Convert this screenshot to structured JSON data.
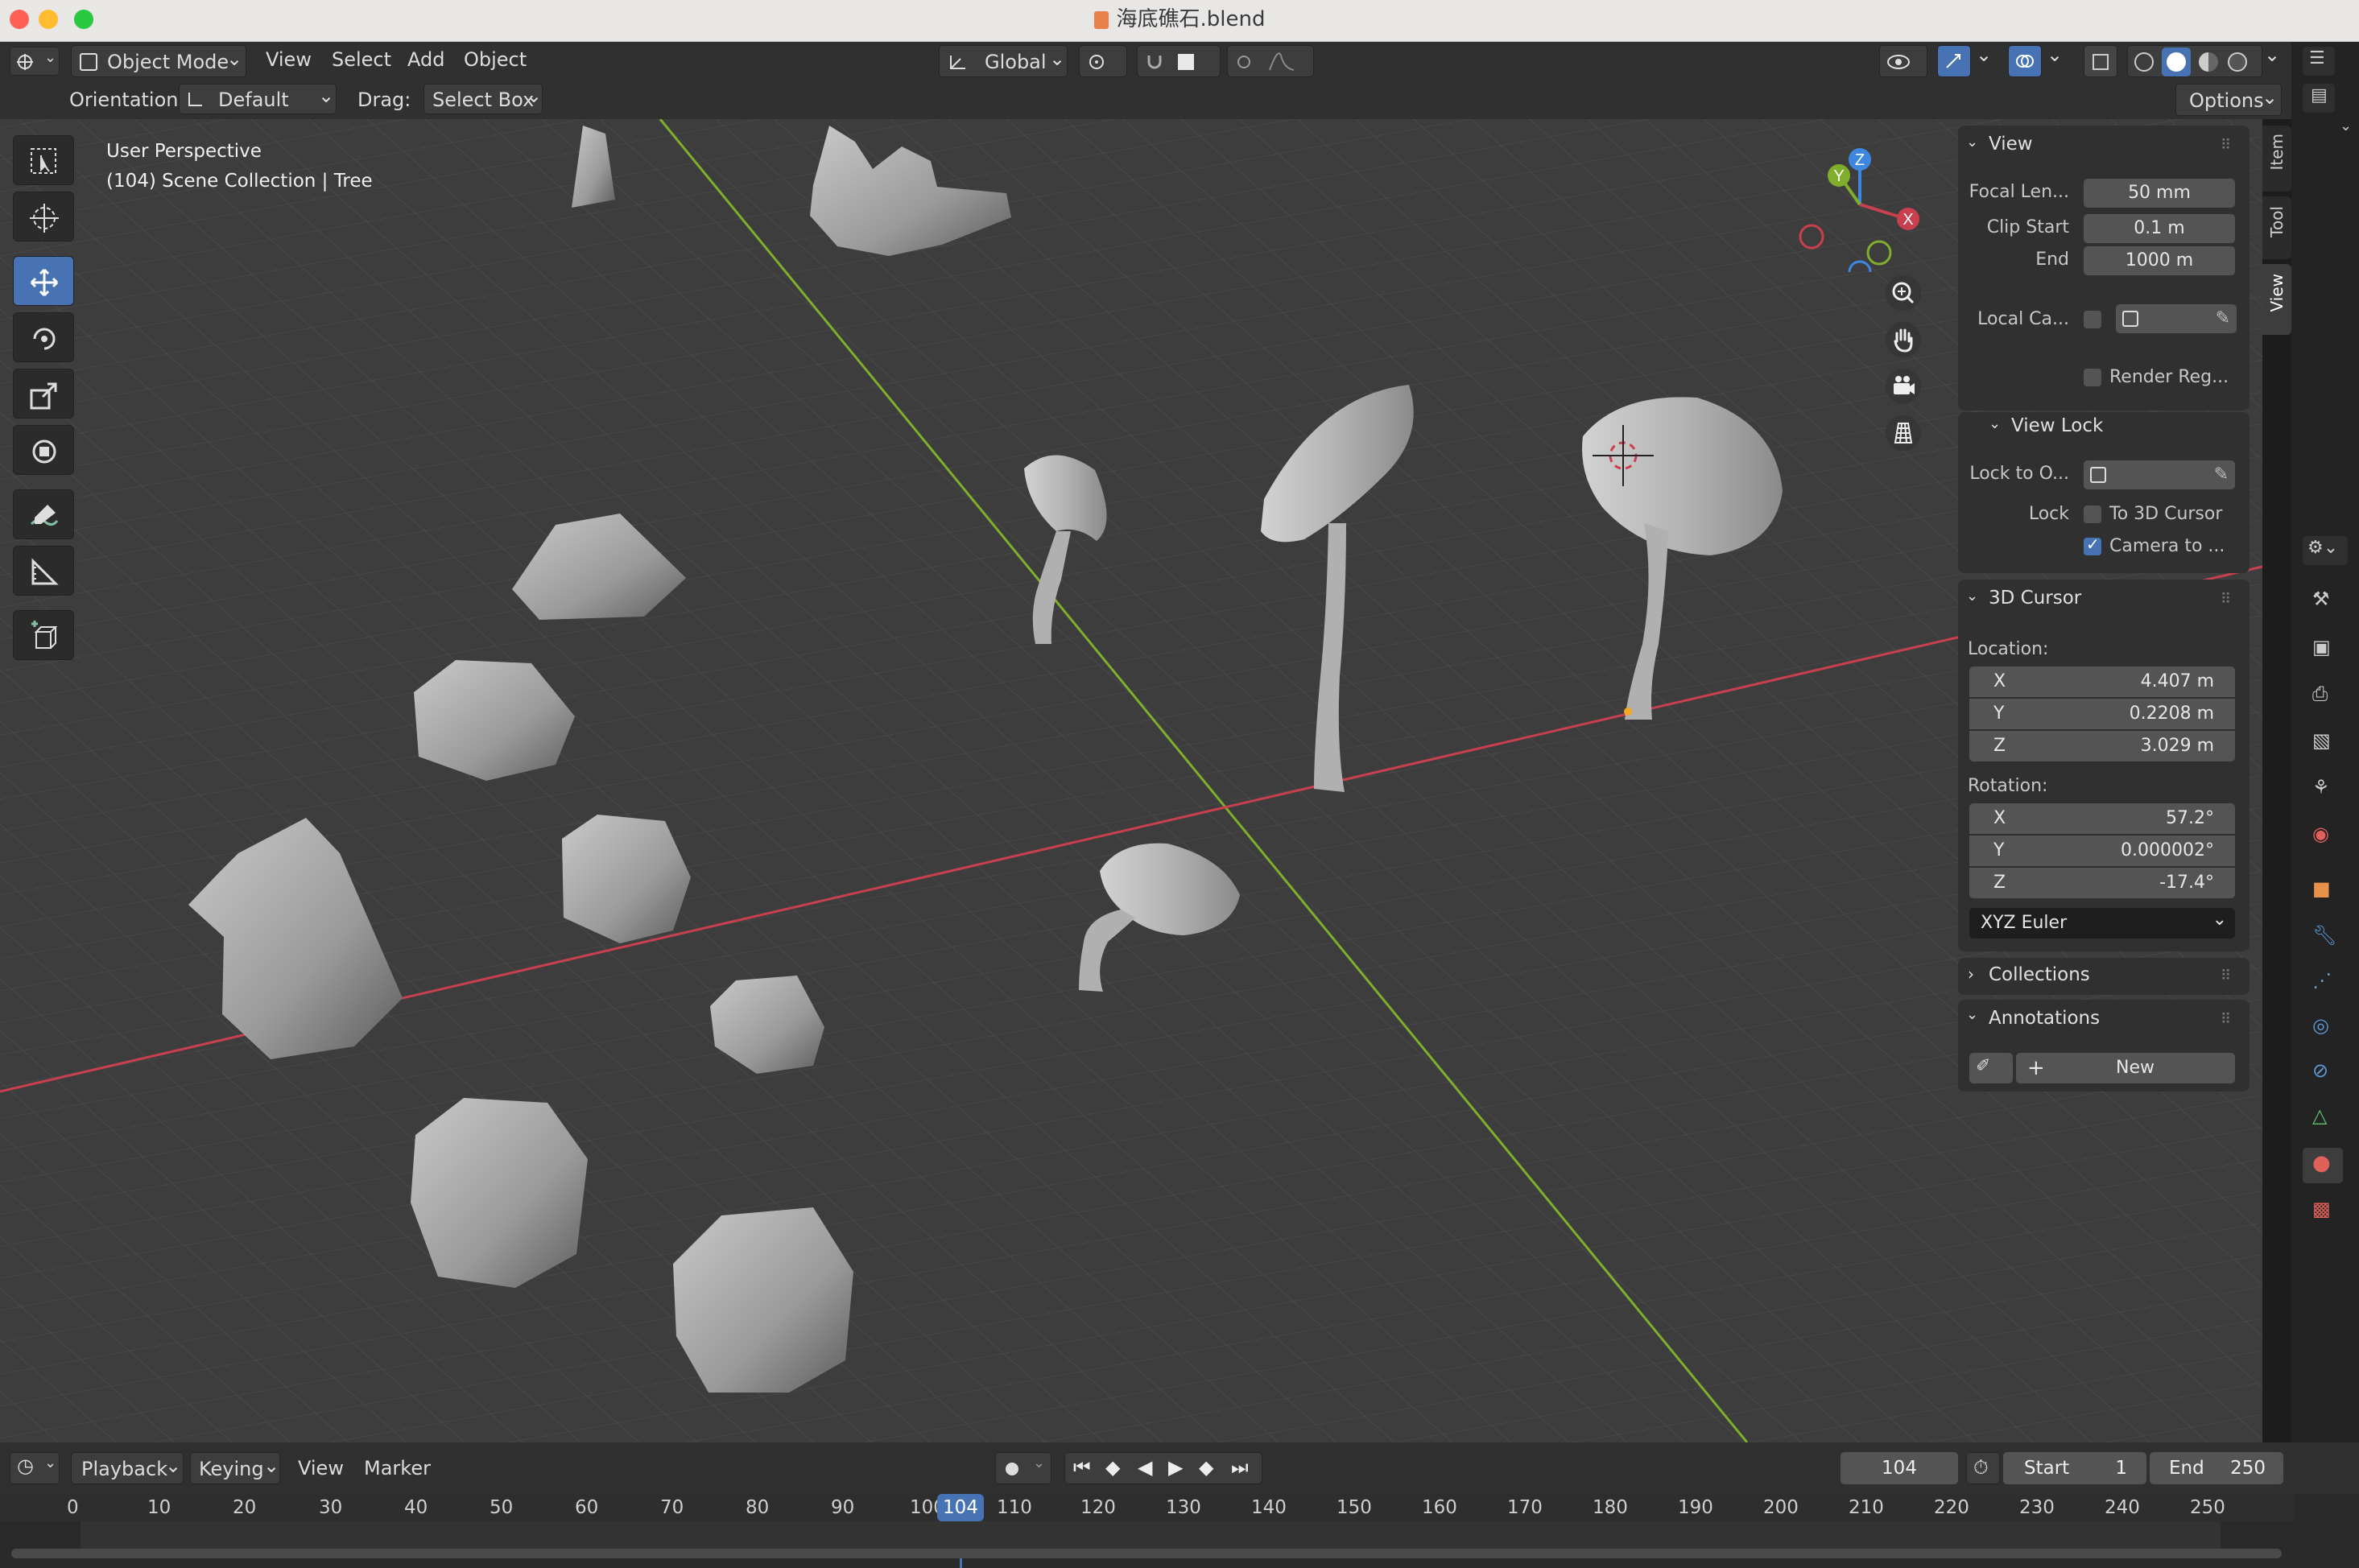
{
  "window": {
    "title": "海底礁石.blend",
    "traffic_colors": [
      "#fe5f57",
      "#febc2e",
      "#28c840"
    ]
  },
  "header": {
    "mode": "Object Mode",
    "menus": [
      "View",
      "Select",
      "Add",
      "Object"
    ],
    "transform_orientation": "Global",
    "options": "Options",
    "orientation_label": "Orientation:",
    "orientation_value": "Default",
    "drag_label": "Drag:",
    "drag_value": "Select Box"
  },
  "viewport": {
    "perspective": "User Perspective",
    "collection": "(104) Scene Collection | Tree",
    "gizmo_axes": [
      "X",
      "Y",
      "Z"
    ]
  },
  "toolbar": {
    "tools": [
      "select-box",
      "cursor",
      "move",
      "rotate",
      "scale",
      "transform",
      "annotate",
      "measure",
      "add-cube"
    ],
    "active": "move"
  },
  "sidebar_tabs": [
    "Item",
    "Tool",
    "View"
  ],
  "n_panel": {
    "view": {
      "title": "View",
      "focal_label": "Focal Len...",
      "focal_value": "50 mm",
      "clip_start_label": "Clip Start",
      "clip_start_value": "0.1 m",
      "end_label": "End",
      "end_value": "1000 m",
      "local_camera_label": "Local Ca...",
      "render_region_label": "Render Reg..."
    },
    "view_lock": {
      "title": "View Lock",
      "lock_to_label": "Lock to O...",
      "lock_label": "Lock",
      "to_3d_cursor": "To 3D Cursor",
      "camera_to": "Camera to ...",
      "to_3d_cursor_checked": false,
      "camera_to_checked": true
    },
    "cursor": {
      "title": "3D Cursor",
      "location_label": "Location:",
      "location": [
        {
          "axis": "X",
          "value": "4.407 m"
        },
        {
          "axis": "Y",
          "value": "0.2208 m"
        },
        {
          "axis": "Z",
          "value": "3.029 m"
        }
      ],
      "rotation_label": "Rotation:",
      "rotation": [
        {
          "axis": "X",
          "value": "57.2°"
        },
        {
          "axis": "Y",
          "value": "0.000002°"
        },
        {
          "axis": "Z",
          "value": "-17.4°"
        }
      ],
      "rotation_mode": "XYZ Euler"
    },
    "collections": {
      "title": "Collections"
    },
    "annotations": {
      "title": "Annotations",
      "new_label": "New"
    }
  },
  "timeline": {
    "menus": [
      "Playback",
      "Keying",
      "View",
      "Marker"
    ],
    "current_frame": "104",
    "start_label": "Start",
    "start_value": "1",
    "end_label": "End",
    "end_value": "250",
    "ruler": [
      "0",
      "10",
      "20",
      "30",
      "40",
      "50",
      "60",
      "70",
      "80",
      "90",
      "100",
      "104",
      "110",
      "120",
      "130",
      "140",
      "150",
      "160",
      "170",
      "180",
      "190",
      "200",
      "210",
      "220",
      "230",
      "240",
      "250"
    ]
  },
  "colors": {
    "accent": "#4772b3",
    "x_axis": "#c8404e",
    "y_axis": "#7fae2c",
    "z_axis": "#3d87e0"
  }
}
